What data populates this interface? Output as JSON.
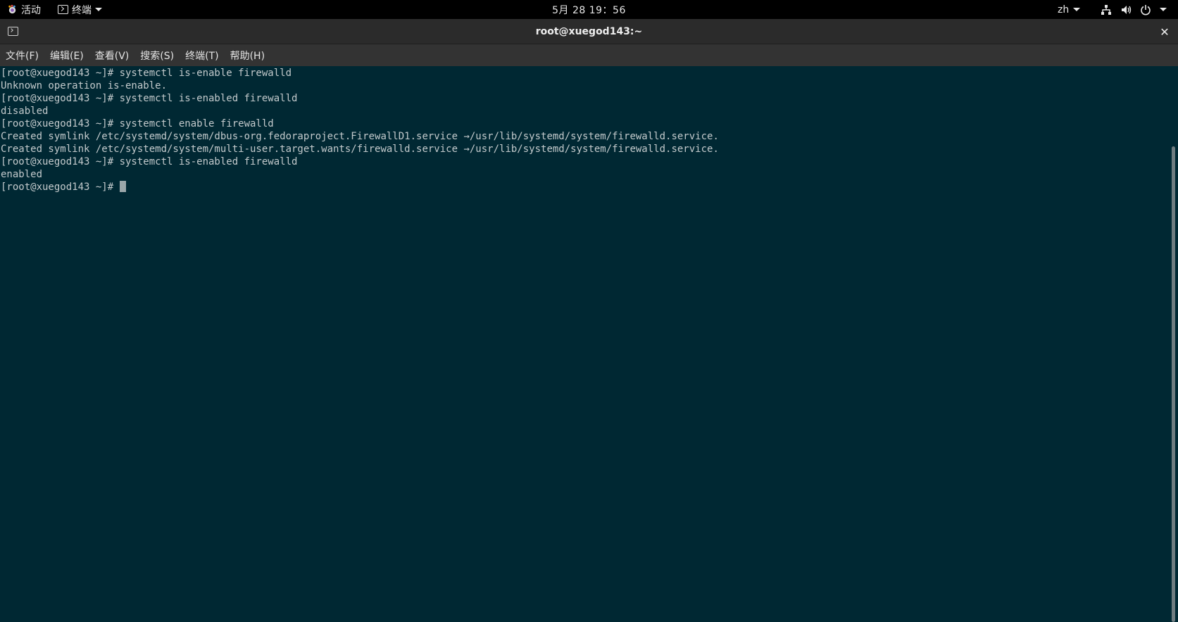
{
  "topbar": {
    "activities_label": "活动",
    "app_menu_label": "终端",
    "clock": "5月 28  19：56",
    "language": "zh",
    "icons": [
      "network-icon",
      "volume-icon",
      "power-icon"
    ]
  },
  "window": {
    "title": "root@xuegod143:~",
    "close_glyph": "✕"
  },
  "menubar": {
    "items": [
      "文件(F)",
      "编辑(E)",
      "查看(V)",
      "搜索(S)",
      "终端(T)",
      "帮助(H)"
    ]
  },
  "terminal": {
    "lines": [
      "[root@xuegod143 ~]# systemctl is-enable firewalld",
      "Unknown operation is-enable.",
      "[root@xuegod143 ~]# systemctl is-enabled firewalld",
      "disabled",
      "[root@xuegod143 ~]# systemctl enable firewalld",
      "Created symlink /etc/systemd/system/dbus-org.fedoraproject.FirewallD1.service →/usr/lib/systemd/system/firewalld.service.",
      "Created symlink /etc/systemd/system/multi-user.target.wants/firewalld.service →/usr/lib/systemd/system/firewalld.service.",
      "[root@xuegod143 ~]# systemctl is-enabled firewalld",
      "enabled"
    ],
    "prompt": "[root@xuegod143 ~]# "
  },
  "colors": {
    "terminal_bg": "#002833",
    "terminal_fg": "#c3cacc",
    "topbar_bg": "#000000",
    "headerbar_bg": "#2b2b2b",
    "menubar_bg": "#333333"
  }
}
